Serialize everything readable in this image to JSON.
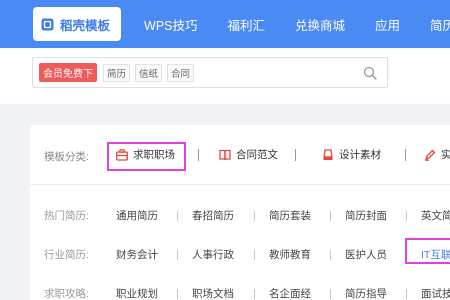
{
  "nav": {
    "items": [
      {
        "label": "稻壳模板"
      },
      {
        "label": "WPS技巧"
      },
      {
        "label": "福利汇"
      },
      {
        "label": "兑换商城"
      },
      {
        "label": "应用"
      },
      {
        "label": "简历定"
      }
    ],
    "logo_icon": "dock-logo-icon",
    "bg_color": "#4a8af4"
  },
  "search": {
    "promo": "会员免费下",
    "hints": [
      "简历",
      "信纸",
      "合同"
    ],
    "icon": "search-icon"
  },
  "categories": {
    "label": "模板分类:",
    "items": [
      {
        "label": "求职职场",
        "icon": "briefcase-icon",
        "selected": true
      },
      {
        "label": "合同范文",
        "icon": "book-icon"
      },
      {
        "label": "设计素材",
        "icon": "paint-bucket-icon"
      },
      {
        "label": "实",
        "icon": "pen-icon"
      }
    ]
  },
  "rows": [
    {
      "label": "热门简历:",
      "items": [
        "通用简历",
        "春招简历",
        "简历套装",
        "简历封面",
        "英文简"
      ]
    },
    {
      "label": "行业简历:",
      "items": [
        "财务会计",
        "人事行政",
        "教师教育",
        "医护人员",
        "IT互联"
      ]
    },
    {
      "label": "求职攻略:",
      "items": [
        "职业规划",
        "职场文档",
        "名企面经",
        "简历指导",
        "面试技"
      ]
    }
  ]
}
